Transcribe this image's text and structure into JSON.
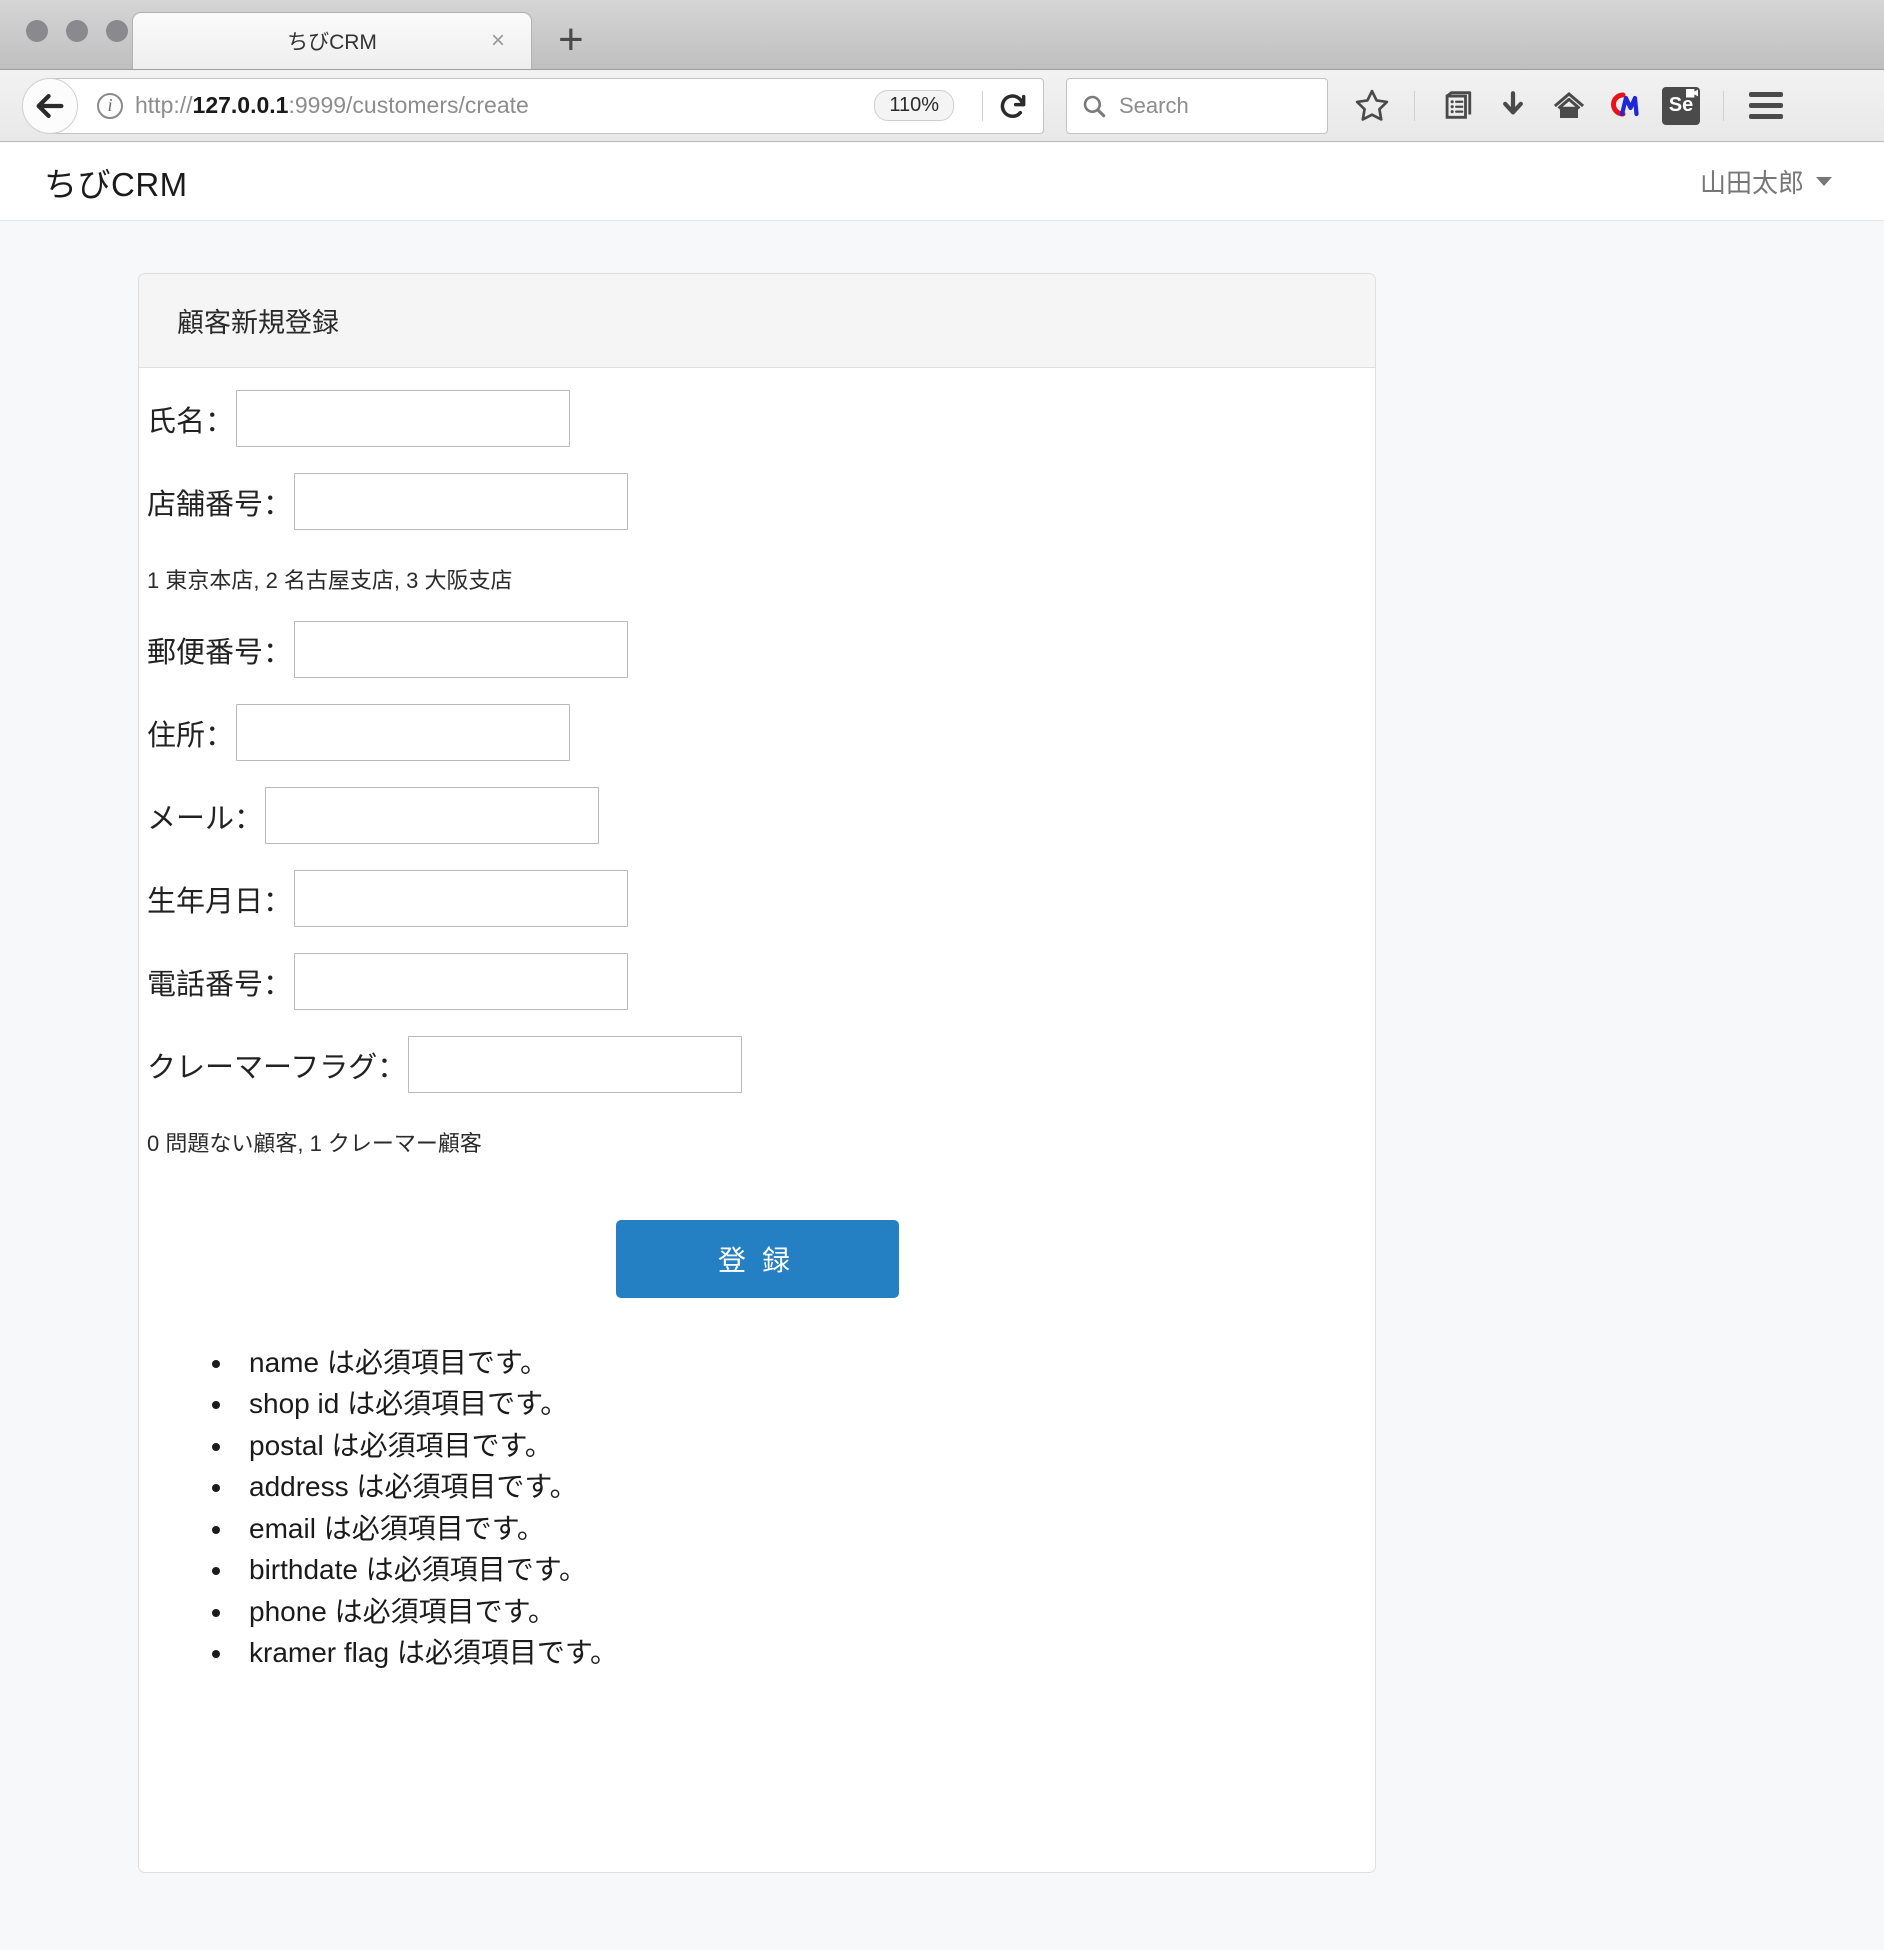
{
  "browser": {
    "tab_title": "ちびCRM",
    "tab_close_glyph": "×",
    "newtab_glyph": "+",
    "url_scheme": "http://",
    "url_host": "127.0.0.1",
    "url_rest": ":9999/customers/create",
    "zoom_level": "110%",
    "search_placeholder": "Search",
    "icons": {
      "back": "back-arrow-icon",
      "info": "i",
      "reload": "reload-icon",
      "search": "search-icon",
      "bookmark": "star-icon",
      "library": "library-icon",
      "downloads": "download-arrow-icon",
      "home": "home-icon",
      "katalon": "katalon-recorder-icon",
      "selenium": "Se",
      "menu": "hamburger-menu-icon"
    }
  },
  "app": {
    "brand": "ちびCRM",
    "user_name": "山田太郎"
  },
  "form": {
    "panel_title": "顧客新規登録",
    "fields": [
      {
        "label": "氏名：",
        "name": "name",
        "value": "",
        "width_class": "w-name"
      },
      {
        "label": "店舗番号：",
        "name": "shop-id",
        "value": "",
        "width_class": "w-shop"
      },
      {
        "label": "郵便番号：",
        "name": "postal",
        "value": "",
        "width_class": "w-postal"
      },
      {
        "label": "住所：",
        "name": "address",
        "value": "",
        "width_class": "w-addr"
      },
      {
        "label": "メール：",
        "name": "email",
        "value": "",
        "width_class": "w-mail"
      },
      {
        "label": "生年月日：",
        "name": "birthdate",
        "value": "",
        "width_class": "w-birth"
      },
      {
        "label": "電話番号：",
        "name": "phone",
        "value": "",
        "width_class": "w-phone"
      },
      {
        "label": "クレーマーフラグ：",
        "name": "kramer-flag",
        "value": "",
        "width_class": "w-kramer"
      }
    ],
    "help_shop": "1 東京本店, 2 名古屋支店, 3 大阪支店",
    "help_kramer": "0 問題ない顧客, 1 クレーマー顧客",
    "submit_label": "登録",
    "errors": [
      "name は必須項目です。",
      "shop id は必須項目です。",
      "postal は必須項目です。",
      "address は必須項目です。",
      "email は必須項目です。",
      "birthdate は必須項目です。",
      "phone は必須項目です。",
      "kramer flag は必須項目です。"
    ]
  },
  "colors": {
    "primary_button": "#2580c3",
    "panel_border": "#dedede",
    "page_bg": "#f7f8fa"
  }
}
